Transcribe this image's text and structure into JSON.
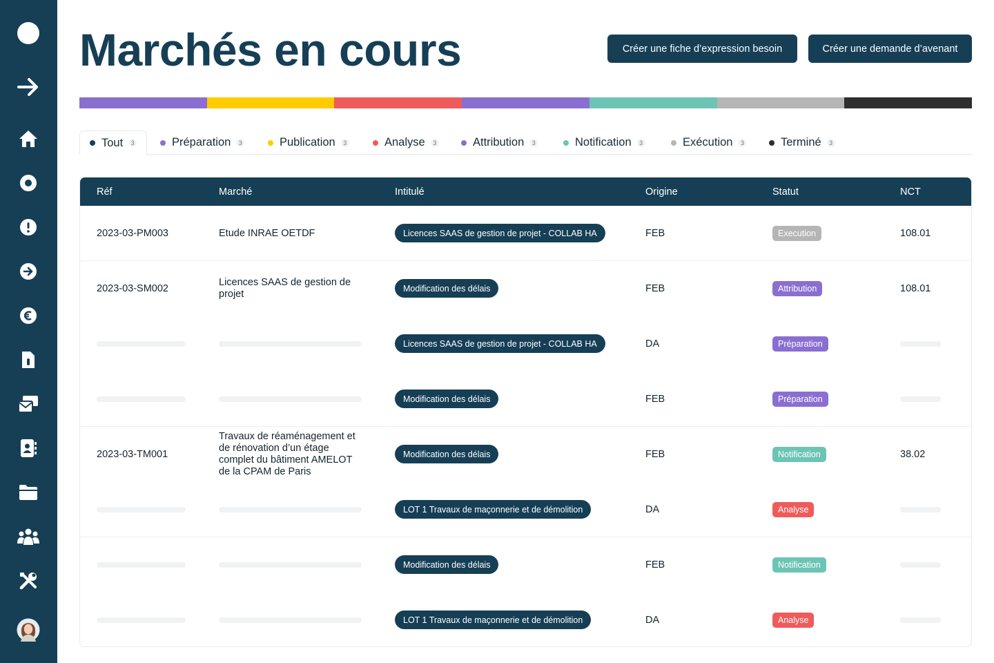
{
  "sidebar": {
    "icons": [
      "circle-logo-icon",
      "arrow-right-icon",
      "home-icon",
      "record-icon",
      "alert-icon",
      "arrow-circle-icon",
      "euro-icon",
      "document-icon",
      "inbox-icon",
      "contact-card-icon",
      "folder-icon",
      "team-icon",
      "tools-icon",
      "user-avatar"
    ]
  },
  "header": {
    "title": "Marchés en cours",
    "button_expression": "Créer une fiche d’expression besoin",
    "button_avenant": "Créer une demande d’avenant"
  },
  "colors": {
    "navy": "#163f56",
    "preparation": "#8a6fd1",
    "publication": "#ffcc00",
    "analyse": "#ef5b5b",
    "attribution": "#8a6fd1",
    "notification": "#6cc4b4",
    "execution": "#b5b5b5",
    "termine": "#2e2e2e"
  },
  "tabs": [
    {
      "label": "Tout",
      "count": "3"
    },
    {
      "label": "Préparation",
      "count": "3"
    },
    {
      "label": "Publication",
      "count": "3"
    },
    {
      "label": "Analyse",
      "count": "3"
    },
    {
      "label": "Attribution",
      "count": "3"
    },
    {
      "label": "Notification",
      "count": "3"
    },
    {
      "label": "Exécution",
      "count": "3"
    },
    {
      "label": "Terminé",
      "count": "3"
    }
  ],
  "table": {
    "columns": [
      "Réf",
      "Marché",
      "Intitulé",
      "Origine",
      "Statut",
      "NCT"
    ],
    "rows": [
      {
        "ref": "2023-03-PM003",
        "marche": "Etude INRAE OETDF",
        "intitule": "Licences SAAS de gestion de projet - COLLAB HA",
        "origine": "FEB",
        "statut": "Execution",
        "nct": "108.01"
      },
      {
        "ref": "2023-03-SM002",
        "marche": "Licences SAAS de gestion de projet",
        "intitule": "Modification des délais",
        "origine": "FEB",
        "statut": "Attribution",
        "nct": "108.01"
      },
      {
        "ref": "",
        "marche": "",
        "intitule": "Licences SAAS de gestion de projet - COLLAB HA",
        "origine": "DA",
        "statut": "Préparation",
        "nct": ""
      },
      {
        "ref": "",
        "marche": "",
        "intitule": "Modification des délais",
        "origine": "FEB",
        "statut": "Préparation",
        "nct": ""
      },
      {
        "ref": "2023-03-TM001",
        "marche": "Travaux de réaménagement et de rénovation d’un étage complet du bâtiment AMELOT de la CPAM de Paris",
        "intitule": "Modification des délais",
        "origine": "FEB",
        "statut": "Notification",
        "nct": "38.02"
      },
      {
        "ref": "",
        "marche": "",
        "intitule": "LOT 1 Travaux de maçonnerie et de démolition",
        "origine": "DA",
        "statut": "Analyse",
        "nct": ""
      },
      {
        "ref": "",
        "marche": "",
        "intitule": "Modification des délais",
        "origine": "FEB",
        "statut": "Notification",
        "nct": ""
      },
      {
        "ref": "",
        "marche": "",
        "intitule": "LOT 1 Travaux de maçonnerie et de démolition",
        "origine": "DA",
        "statut": "Analyse",
        "nct": ""
      }
    ]
  }
}
